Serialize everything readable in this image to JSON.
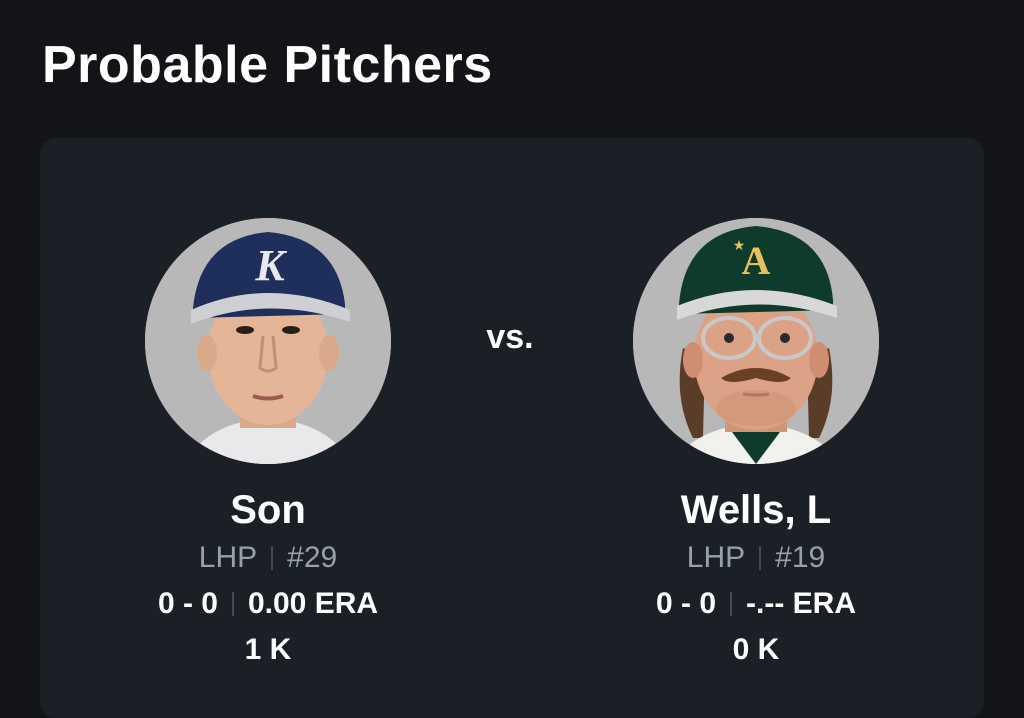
{
  "page": {
    "title": "Probable Pitchers"
  },
  "matchup": {
    "vs_label": "vs.",
    "pitchers": [
      {
        "name": "Son",
        "position": "LHP",
        "number": "#29",
        "record": "0 - 0",
        "era": "0.00 ERA",
        "strikeouts": "1 K",
        "cap_logo": "K",
        "cap_color": "#1f2f5c"
      },
      {
        "name": "Wells, L",
        "position": "LHP",
        "number": "#19",
        "record": "0 - 0",
        "era": "-.-- ERA",
        "strikeouts": "0 K",
        "cap_logo": "A",
        "cap_color": "#0f3b2c"
      }
    ]
  }
}
